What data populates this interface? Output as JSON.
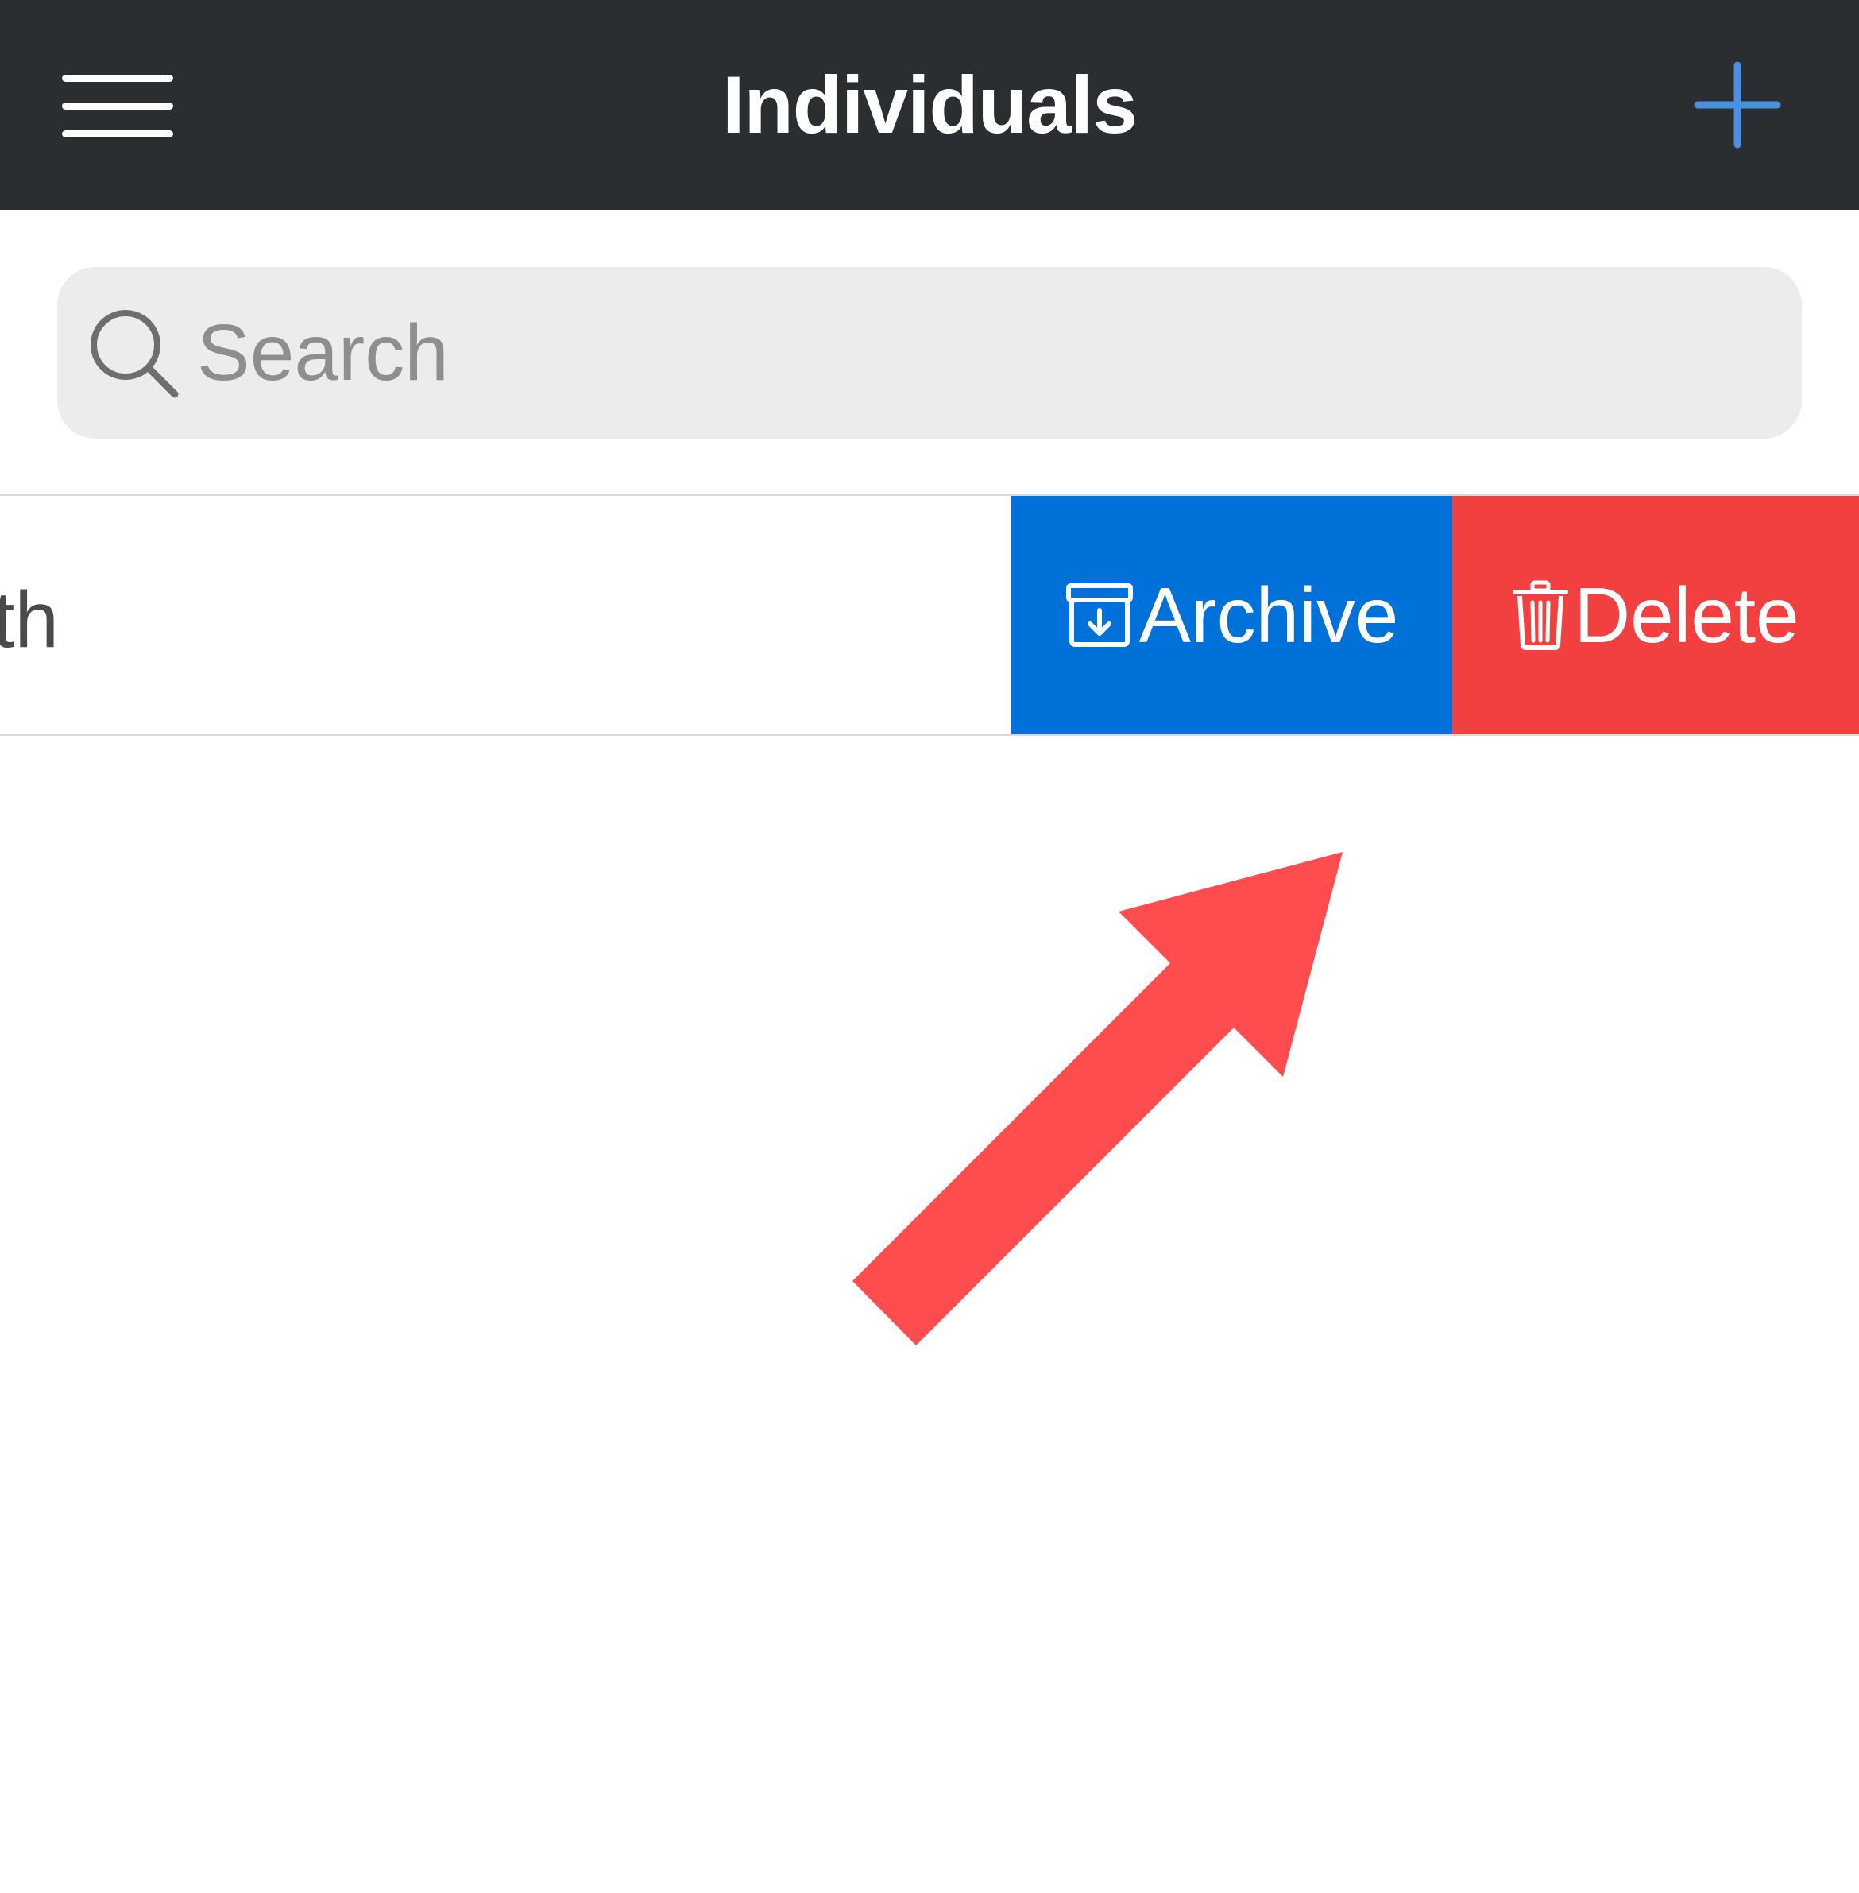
{
  "header": {
    "title": "Individuals",
    "menu_icon": "hamburger-menu-icon",
    "add_icon": "plus-icon",
    "accent_color": "#4a90e2",
    "background_color": "#2a2e31"
  },
  "search": {
    "placeholder": "Search",
    "value": "",
    "icon": "search-icon"
  },
  "list": {
    "rows": [
      {
        "label_visible_fragment": "th",
        "swipe_actions": [
          {
            "label": "Archive",
            "icon": "archive-box-icon",
            "color": "#0071d9"
          },
          {
            "label": "Delete",
            "icon": "trash-icon",
            "color": "#f23f3f"
          }
        ]
      }
    ]
  },
  "annotation": {
    "type": "arrow",
    "color": "#ff4d4f",
    "points_to": "archive-button"
  }
}
